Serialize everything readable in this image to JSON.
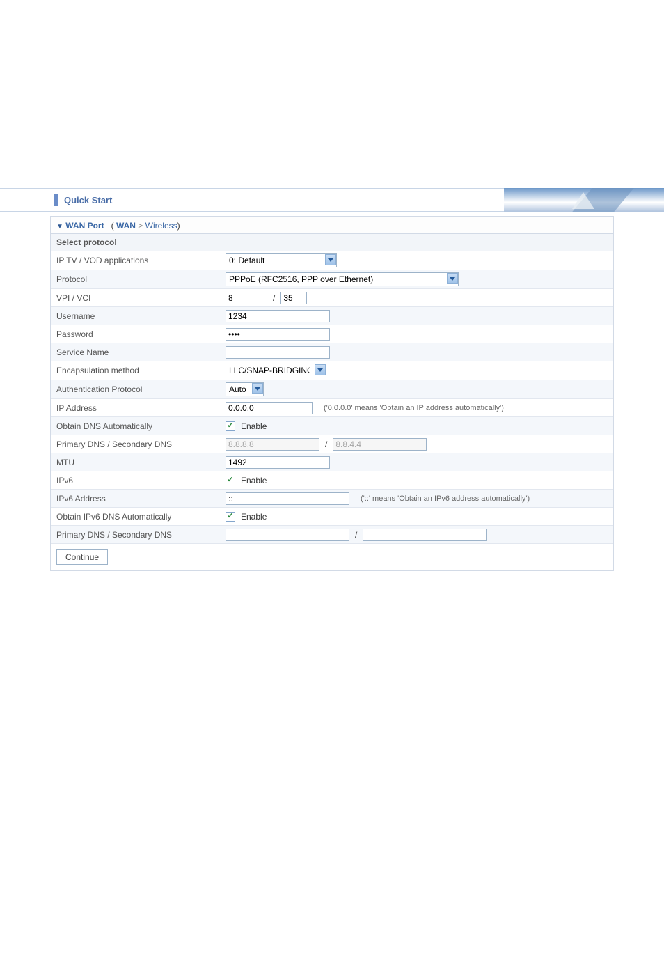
{
  "header": {
    "title": "Quick Start"
  },
  "breadcrumb": {
    "section": "WAN Port",
    "active": "WAN",
    "next": "Wireless"
  },
  "section": {
    "subhead": "Select protocol"
  },
  "rows": {
    "iptv_label": "IP TV / VOD applications",
    "iptv_value": "0: Default",
    "protocol_label": "Protocol",
    "protocol_value": "PPPoE (RFC2516, PPP over Ethernet)",
    "vpivci_label": "VPI / VCI",
    "vpi_value": "8",
    "vci_value": "35",
    "username_label": "Username",
    "username_value": "1234",
    "password_label": "Password",
    "password_value": "••••",
    "servicename_label": "Service Name",
    "servicename_value": "",
    "encaps_label": "Encapsulation method",
    "encaps_value": "LLC/SNAP-BRIDGING",
    "authproto_label": "Authentication Protocol",
    "authproto_value": "Auto",
    "ipaddr_label": "IP Address",
    "ipaddr_value": "0.0.0.0",
    "ipaddr_hint": "('0.0.0.0' means 'Obtain an IP address automatically')",
    "obtaindns_label": "Obtain DNS Automatically",
    "enable_label": "Enable",
    "dns_label": "Primary DNS / Secondary DNS",
    "dns1_value": "8.8.8.8",
    "dns2_value": "8.8.4.4",
    "mtu_label": "MTU",
    "mtu_value": "1492",
    "ipv6_label": "IPv6",
    "ipv6addr_label": "IPv6 Address",
    "ipv6addr_value": "::",
    "ipv6addr_hint": "('::' means 'Obtain an IPv6 address automatically')",
    "obtainipv6dns_label": "Obtain IPv6 DNS Automatically",
    "ipv6dns_label": "Primary DNS / Secondary DNS",
    "ipv6dns1_value": "",
    "ipv6dns2_value": ""
  },
  "footer": {
    "continue_label": "Continue"
  }
}
